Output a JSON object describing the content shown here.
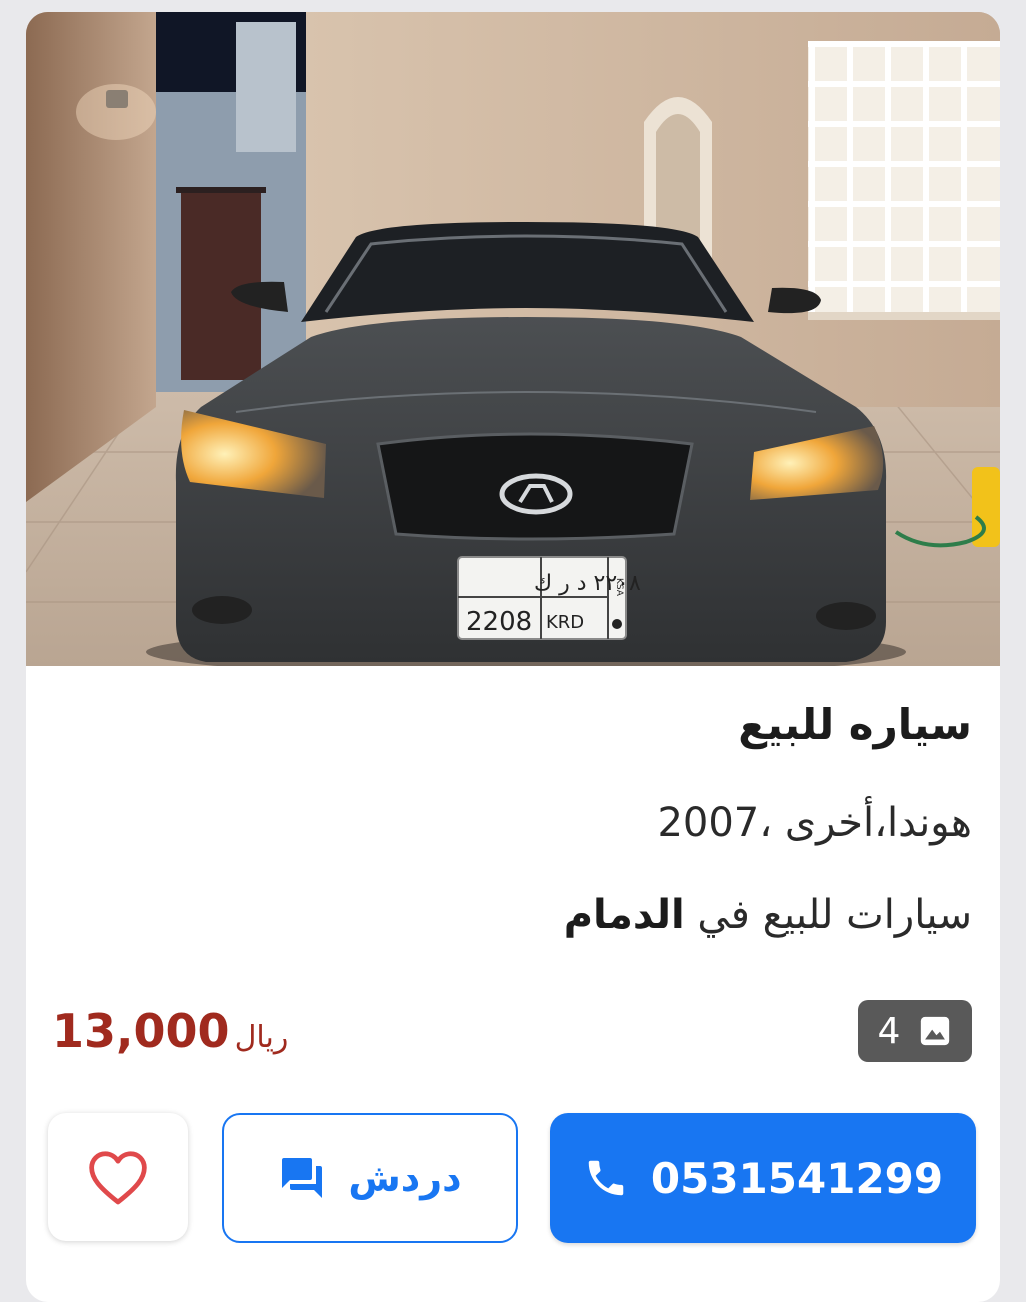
{
  "listing": {
    "title": "سياره للبيع",
    "details": "هوندا،أخرى ،2007",
    "location_prefix": "سيارات للبيع في",
    "location_city": "الدمام",
    "price_amount": "13,000",
    "price_currency": "ريال",
    "photo_count": "4",
    "photo_icon": "image-icon"
  },
  "photo": {
    "plate_arabic": "٢٢٠٨ د ر ك",
    "plate_latin_number": "2208",
    "plate_latin_letters": "KRD",
    "plate_side": "KSA"
  },
  "actions": {
    "call_number": "0531541299",
    "call_icon": "phone-icon",
    "chat_label": "دردش",
    "chat_icon": "chat-icon",
    "favorite_icon": "heart-outline-icon"
  },
  "colors": {
    "primary": "#1876f2",
    "price": "#a02a1e",
    "badge": "#595959",
    "heart": "#e0494b"
  }
}
